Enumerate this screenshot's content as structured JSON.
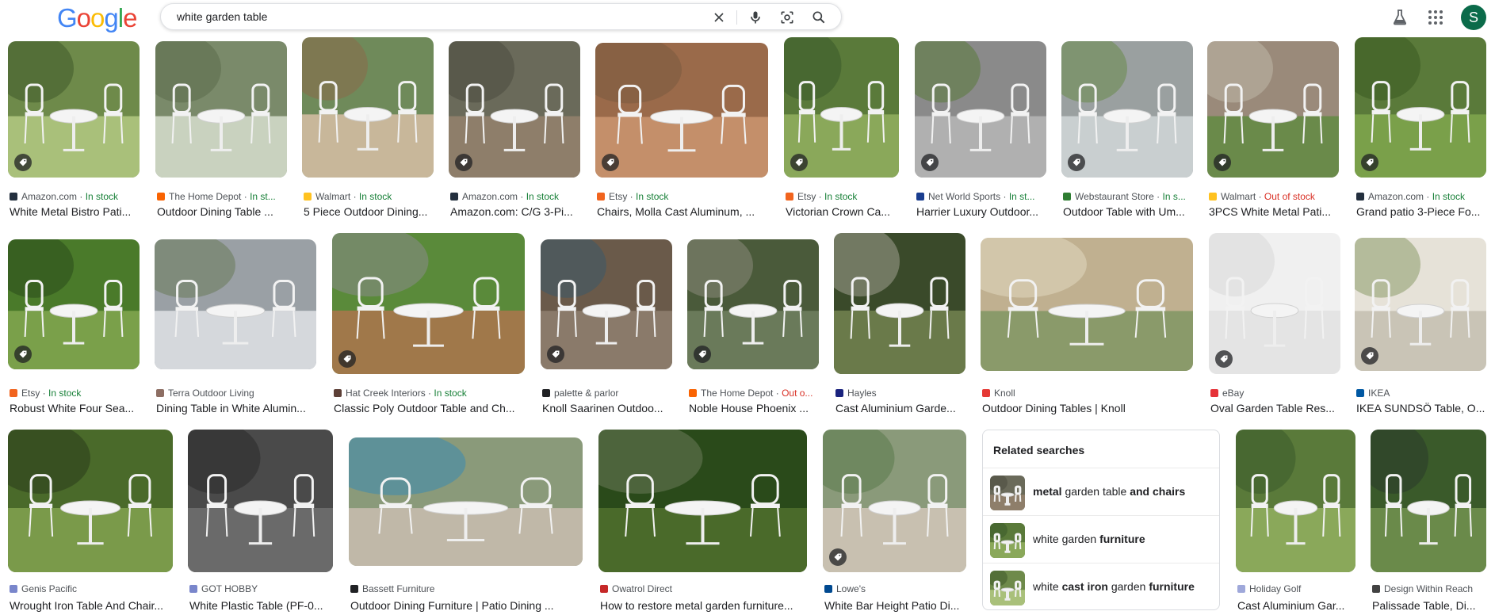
{
  "header": {
    "logo_letters": [
      {
        "ch": "G",
        "color": "#4285F4"
      },
      {
        "ch": "o",
        "color": "#EA4335"
      },
      {
        "ch": "o",
        "color": "#FBBC05"
      },
      {
        "ch": "g",
        "color": "#4285F4"
      },
      {
        "ch": "l",
        "color": "#34A853"
      },
      {
        "ch": "e",
        "color": "#EA4335"
      }
    ],
    "search_query": "white garden table",
    "avatar_letter": "S",
    "icons": [
      "close-icon",
      "microphone-icon",
      "lens-icon",
      "search-icon",
      "labs-icon",
      "apps-icon"
    ]
  },
  "results": [
    {
      "source": "Amazon.com",
      "stock": "In stock",
      "stock_status": "in",
      "title": "White Metal Bistro Pati...",
      "fav_color": "#232f3e",
      "tag": true
    },
    {
      "source": "The Home Depot",
      "stock": "In st...",
      "stock_status": "in",
      "title": "Outdoor Dining Table ...",
      "fav_color": "#f96302",
      "tag": false
    },
    {
      "source": "Walmart",
      "stock": "In stock",
      "stock_status": "in",
      "title": "5 Piece Outdoor Dining...",
      "fav_color": "#ffc220",
      "tag": false
    },
    {
      "source": "Amazon.com",
      "stock": "In stock",
      "stock_status": "in",
      "title": "Amazon.com: C/G 3-Pi...",
      "fav_color": "#232f3e",
      "tag": true
    },
    {
      "source": "Etsy",
      "stock": "In stock",
      "stock_status": "in",
      "title": "Chairs, Molla Cast Aluminum, ...",
      "fav_color": "#f1641e",
      "tag": true
    },
    {
      "source": "Etsy",
      "stock": "In stock",
      "stock_status": "in",
      "title": "Victorian Crown Ca...",
      "fav_color": "#f1641e",
      "tag": true
    },
    {
      "source": "Net World Sports",
      "stock": "In st...",
      "stock_status": "in",
      "title": "Harrier Luxury Outdoor...",
      "fav_color": "#1a3d8f",
      "tag": true
    },
    {
      "source": "Webstaurant Store",
      "stock": "In s...",
      "stock_status": "in",
      "title": "Outdoor Table with Um...",
      "fav_color": "#2e7d32",
      "tag": true
    },
    {
      "source": "Walmart",
      "stock": "Out of stock",
      "stock_status": "out",
      "title": "3PCS White Metal Pati...",
      "fav_color": "#ffc220",
      "tag": true
    },
    {
      "source": "Amazon.com",
      "stock": "In stock",
      "stock_status": "in",
      "title": "Grand patio 3-Piece Fo...",
      "fav_color": "#232f3e",
      "tag": true
    },
    {
      "source": "Etsy",
      "stock": "In stock",
      "stock_status": "in",
      "title": "Robust White Four Sea...",
      "fav_color": "#f1641e",
      "tag": true
    },
    {
      "source": "Terra Outdoor Living",
      "stock": "",
      "stock_status": "",
      "title": "Dining Table in White Alumin...",
      "fav_color": "#8d6e63",
      "tag": false
    },
    {
      "source": "Hat Creek Interiors",
      "stock": "In stock",
      "stock_status": "in",
      "title": "Classic Poly Outdoor Table and Ch...",
      "fav_color": "#5d4037",
      "tag": true
    },
    {
      "source": "palette & parlor",
      "stock": "",
      "stock_status": "",
      "title": "Knoll Saarinen Outdoo...",
      "fav_color": "#202124",
      "tag": true
    },
    {
      "source": "The Home Depot",
      "stock": "Out o...",
      "stock_status": "out",
      "title": "Noble House Phoenix ...",
      "fav_color": "#f96302",
      "tag": true
    },
    {
      "source": "Hayles",
      "stock": "",
      "stock_status": "",
      "title": "Cast Aluminium Garde...",
      "fav_color": "#1a237e",
      "tag": false
    },
    {
      "source": "Knoll",
      "stock": "",
      "stock_status": "",
      "title": "Outdoor Dining Tables | Knoll",
      "fav_color": "#e53935",
      "tag": false
    },
    {
      "source": "eBay",
      "stock": "",
      "stock_status": "",
      "title": "Oval Garden Table Res...",
      "fav_color": "#e53238",
      "tag": true
    },
    {
      "source": "IKEA",
      "stock": "",
      "stock_status": "",
      "title": "IKEA SUNDSÖ Table, O...",
      "fav_color": "#0058a3",
      "tag": true
    },
    {
      "source": "Genis Pacific",
      "stock": "",
      "stock_status": "",
      "title": "Wrought Iron Table And Chair...",
      "fav_color": "#7986cb",
      "tag": false
    },
    {
      "source": "GOT HOBBY",
      "stock": "",
      "stock_status": "",
      "title": "White Plastic Table (PF-0...",
      "fav_color": "#7986cb",
      "tag": false
    },
    {
      "source": "Bassett Furniture",
      "stock": "",
      "stock_status": "",
      "title": "Outdoor Dining Furniture | Patio Dining ...",
      "fav_color": "#202124",
      "tag": false
    },
    {
      "source": "Owatrol Direct",
      "stock": "",
      "stock_status": "",
      "title": "How to restore metal garden furniture...",
      "fav_color": "#c62828",
      "tag": false
    },
    {
      "source": "Lowe's",
      "stock": "",
      "stock_status": "",
      "title": "White Bar Height Patio Di...",
      "fav_color": "#004990",
      "tag": true
    },
    {
      "source": "Holiday Golf",
      "stock": "",
      "stock_status": "",
      "title": "Cast Aluminium Gar...",
      "fav_color": "#9fa8da",
      "tag": false
    },
    {
      "source": "Design Within Reach",
      "stock": "",
      "stock_status": "",
      "title": "Palissade Table, Di...",
      "fav_color": "#424242",
      "tag": false
    }
  ],
  "related": {
    "title": "Related searches",
    "items": [
      {
        "parts": [
          {
            "t": "metal",
            "b": true
          },
          {
            "t": " garden table ",
            "b": false
          },
          {
            "t": "and chairs",
            "b": true
          }
        ]
      },
      {
        "parts": [
          {
            "t": "white garden ",
            "b": false
          },
          {
            "t": "furniture",
            "b": true
          }
        ]
      },
      {
        "parts": [
          {
            "t": "white ",
            "b": false
          },
          {
            "t": "cast iron",
            "b": true
          },
          {
            "t": " garden ",
            "b": false
          },
          {
            "t": "furniture",
            "b": true
          }
        ]
      }
    ]
  }
}
